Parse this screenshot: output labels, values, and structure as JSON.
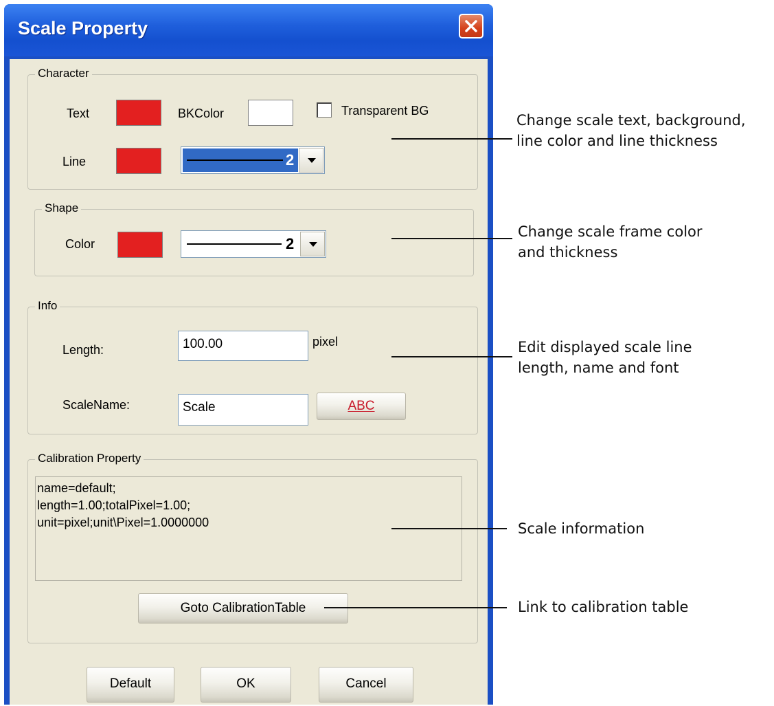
{
  "window": {
    "title": "Scale Property"
  },
  "character": {
    "legend": "Character",
    "text_label": "Text",
    "bkcolor_label": "BKColor",
    "transparent_label": "Transparent BG",
    "transparent_checked": false,
    "line_label": "Line",
    "line_thickness": "2",
    "text_color": "#e32020",
    "bk_color": "#ffffff",
    "line_color": "#e32020"
  },
  "shape": {
    "legend": "Shape",
    "color_label": "Color",
    "frame_color": "#e32020",
    "thickness": "2"
  },
  "info": {
    "legend": "Info",
    "length_label": "Length:",
    "length_value": "100.00",
    "length_unit": "pixel",
    "scalename_label": "ScaleName:",
    "scalename_value": "Scale",
    "font_button": "ABC"
  },
  "calibration": {
    "legend": "Calibration Property",
    "lines": [
      "name=default;",
      "length=1.00;totalPixel=1.00;",
      "unit=pixel;unit\\Pixel=1.0000000"
    ],
    "goto_button": "Goto CalibrationTable"
  },
  "footer": {
    "default_button": "Default",
    "ok_button": "OK",
    "cancel_button": "Cancel"
  },
  "annotations": {
    "a1_line1": "Change scale text, background,",
    "a1_line2": "line color and line thickness",
    "a2_line1": "Change scale frame color",
    "a2_line2": "and thickness",
    "a3_line1": "Edit displayed scale line",
    "a3_line2": "length, name and font",
    "a4": "Scale information",
    "a5": "Link to calibration table"
  },
  "colors": {
    "titlebar": "#1f5fdc",
    "dialog_bg": "#ece9d8",
    "selection": "#316ac5",
    "swatch_red": "#e32020"
  }
}
